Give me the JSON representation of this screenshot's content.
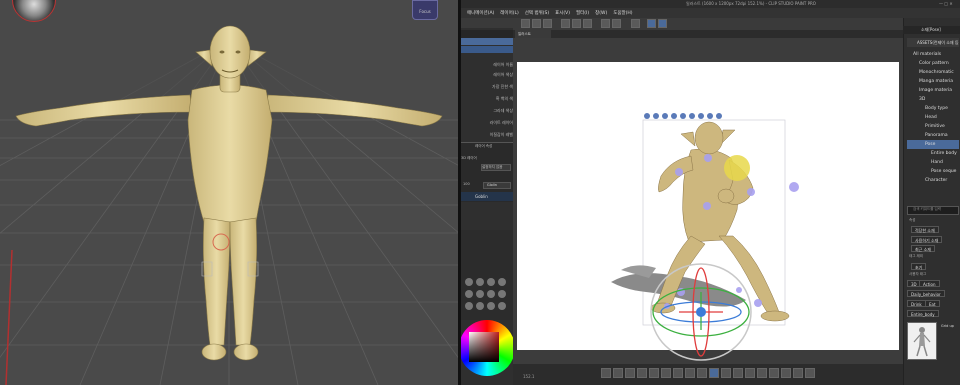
{
  "left_view": {
    "top_right_label": "Focus"
  },
  "right_app": {
    "title": "일러스트 (1600 x 1200px 72dpi 152.1%) - CLIP STUDIO PAINT PRO",
    "menu": [
      "애니메이션(A)",
      "레이어(L)",
      "선택 범위(S)",
      "표시(V)",
      "필터(I)",
      "창(W)",
      "도움말(H)"
    ],
    "panel_tab": "레이어 속성",
    "canvas_tab": "일러스트",
    "layer_names": [
      "레이어 이름",
      "레이어 색상",
      "가장 진한 색",
      "흑 백의 색",
      "그라데 색상",
      "라이트 레이어",
      "이질감이 레벨"
    ],
    "layer_row_number": "100",
    "object_field": "Glolin",
    "layer_settings_label": "레이어 속성",
    "layer_settings_a": "3D 레이어",
    "layer_settings_b": "설정하지 않음",
    "selected_object": "Goblin"
  },
  "materials": {
    "header": "소재[Pose]",
    "asset_header": "ASSETS(런제이 소재 등)",
    "tree": [
      {
        "label": "All materials",
        "indent": 1
      },
      {
        "label": "Color pattern",
        "indent": 2
      },
      {
        "label": "Monochromatic",
        "indent": 2
      },
      {
        "label": "Manga materia",
        "indent": 2
      },
      {
        "label": "Image materia",
        "indent": 2
      },
      {
        "label": "3D",
        "indent": 2
      },
      {
        "label": "Body type",
        "indent": 3
      },
      {
        "label": "Head",
        "indent": 3
      },
      {
        "label": "Primitive",
        "indent": 3
      },
      {
        "label": "Panorama",
        "indent": 3
      },
      {
        "label": "Pose",
        "indent": 3
      },
      {
        "label": "Entire body",
        "indent": 4
      },
      {
        "label": "Hand",
        "indent": 4
      },
      {
        "label": "Pose seque",
        "indent": 4
      },
      {
        "label": "Character",
        "indent": 3
      }
    ],
    "search_placeholder": "검색 키워드를 입력",
    "section_label": "속성",
    "filter_buttons": [
      "적당한 소재",
      "사용하기 소재",
      "최근 소재"
    ],
    "tag_header": "태그 제외",
    "tag_clear": "초기",
    "tag_list_header": "사용자 태그",
    "tags": [
      "3D",
      "Action",
      "Daily_behavior",
      "Drink",
      "Eat",
      "Entire_body"
    ],
    "thumb_label": "Grid up"
  },
  "colors": {
    "accent": "#4a7ab8",
    "highlight": "#e8d84a",
    "handle": "#a8a0f0",
    "rotate_x": "#e03c3c",
    "rotate_y": "#3cb040",
    "rotate_z": "#3c7cd8"
  },
  "status_bar": {
    "zoom": "152.1"
  }
}
